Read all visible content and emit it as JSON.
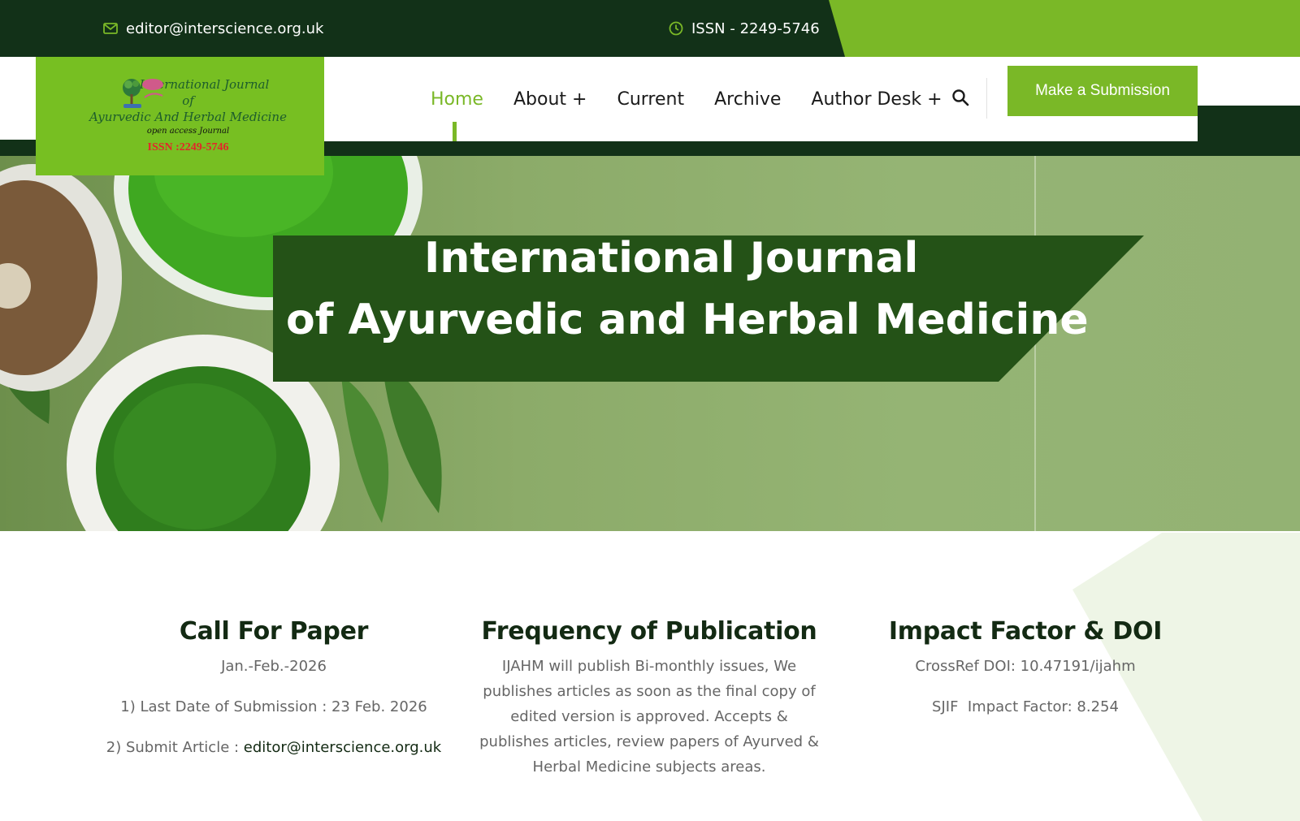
{
  "topbar": {
    "email": "editor@interscience.org.uk",
    "issn": "ISSN - 2249-5746",
    "icons": {
      "email": "envelope-icon",
      "issn": "clock-icon"
    }
  },
  "logo": {
    "line1": "International Journal",
    "line2": "of",
    "line3": "Ayurvedic And Herbal Medicine",
    "line4": "open access Journal",
    "issn": "ISSN :2249-5746"
  },
  "nav": {
    "items": [
      {
        "label": "Home",
        "active": true
      },
      {
        "label": "About +"
      },
      {
        "label": "Current"
      },
      {
        "label": "Archive"
      },
      {
        "label": "Author Desk +"
      }
    ],
    "search_icon": "search-icon",
    "submit_label": "Make a Submission"
  },
  "hero": {
    "line1": "International Journal",
    "line2": "of Ayurvedic and Herbal Medicine"
  },
  "info": {
    "call_for_paper": {
      "title": "Call For Paper",
      "issue": "Jan.-Feb.-2026",
      "last_date": "1) Last Date of Submission : 23 Feb. 2026",
      "submit_prefix": "2) Submit Article : ",
      "submit_email": "editor@interscience.org.uk"
    },
    "frequency": {
      "title": "Frequency of Publication",
      "text": "IJAHM will publish Bi-monthly issues, We publishes articles as soon as the final copy of edited version is approved. Accepts & publishes articles, review papers of Ayurved & Herbal Medicine subjects areas."
    },
    "impact": {
      "title": "Impact Factor & DOI",
      "doi": "CrossRef DOI: 10.47191/ijahm",
      "sjif": "SJIF  Impact Factor: 8.254"
    }
  },
  "colors": {
    "dark_green": "#123118",
    "accent_green": "#7ab827",
    "banner_green": "#245217",
    "logo_bg": "#77bf22"
  }
}
